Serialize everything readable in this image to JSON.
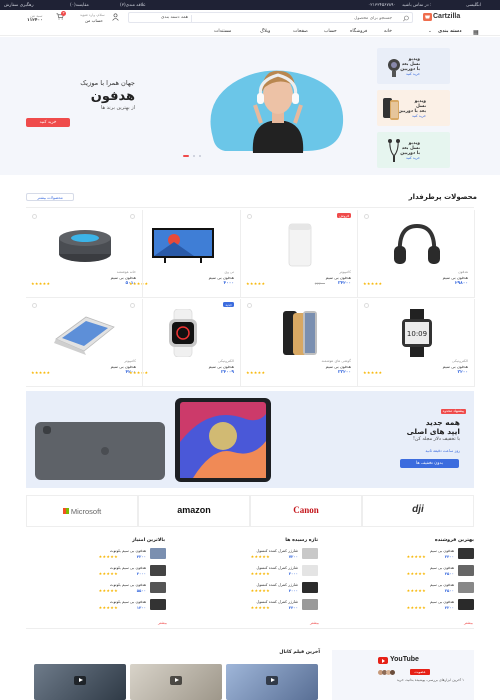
{
  "topbar": {
    "language": "انگلیسی",
    "phone": "۰۲۱۳۳۴۵۶۷۸۹۰",
    "phone_label": "در تماس باشید :",
    "compare": "مقایسه(۰)",
    "wishlist": "علاقه مندی(۳)",
    "tracking": "رهگیری سفارش"
  },
  "header": {
    "logo": "Cartzilla",
    "search_placeholder": "جستجو برای محصول",
    "category": "همه دسته بندی",
    "account_top": "سلام، وارد شوید",
    "account_bottom": "حساب من",
    "cart_top": "سبد من",
    "cart_total": "۱۱۲۴۰۰",
    "cart_count": "۳"
  },
  "nav": {
    "menu": "دسته بندی",
    "items": [
      "خانه",
      "فروشگاه",
      "حساب",
      "صفحات",
      "وبلاگ",
      "مستندات"
    ]
  },
  "hero": {
    "subtitle": "جهان همرا با موزیک",
    "title": "هدفون",
    "tagline": "از بهترین برند ها",
    "button": "خرید کنید",
    "side_cards": [
      {
        "title": "ویدیو",
        "line2": "نسل بعد",
        "line3": "با دوربین",
        "link": "خرید کنید",
        "color": "#e9eef8"
      },
      {
        "title": "ویدیو",
        "line2": "نسل",
        "line3": "بعد با دوربین",
        "link": "خرید کنید",
        "color": "#fbf0e6"
      },
      {
        "title": "ویدیو",
        "line2": "نسل بعد",
        "line3": "با دوربین",
        "link": "خرید کنید",
        "color": "#e6f5ef"
      }
    ]
  },
  "products": {
    "title": "محصولات پرطرفدار",
    "more_button": "محصولات بیشتر",
    "items": [
      {
        "cat": "هدفون",
        "name": "هدفون بی سیم",
        "price": "۲۹۸۰۰",
        "old": "",
        "badge": "",
        "img": "headphones"
      },
      {
        "cat": "کامپیوتر",
        "name": "هدفون بی سیم",
        "price": "۳۴۲۰۰",
        "old": "۴۴۴۰۰",
        "badge": "فروش",
        "img": "router"
      },
      {
        "cat": "تی وی",
        "name": "هدفون بی سیم",
        "price": "۴۰۰۰",
        "old": "",
        "badge": "",
        "img": "tv"
      },
      {
        "cat": "خانه هوشمند",
        "name": "هدفون بی سیم",
        "price": "۵۰۱۰",
        "old": "",
        "badge": "",
        "img": "speaker"
      },
      {
        "cat": "الکترونیکی",
        "name": "هدفون بی سیم",
        "price": "۳۲۰۰",
        "old": "",
        "badge": "",
        "img": "watch"
      },
      {
        "cat": "گوشی های هوشمند",
        "name": "هدفون بی سیم",
        "price": "۳۳۲۰۰",
        "old": "",
        "badge": "",
        "img": "phones"
      },
      {
        "cat": "الکترونیکی",
        "name": "هدفون بی سیم",
        "price": "۳۴۰۰۹",
        "old": "",
        "badge": "جدید",
        "img": "applewatch"
      },
      {
        "cat": "کامپیوتر",
        "name": "هدفون بی سیم",
        "price": "۴۲۰۰",
        "old": "",
        "badge": "",
        "img": "laptop"
      }
    ]
  },
  "banner": {
    "badge": "پیشنهاد محدود",
    "line1": "همه جدید",
    "line2": "ایپد های اصلی",
    "line3": "با تخفیف دلار مجله کن!",
    "countdown": "روز  ساعت  دقیقه  ثانیه",
    "button": "بدون تخفیف ها"
  },
  "brands": [
    "Microsoft",
    "amazon",
    "Canon",
    "dji"
  ],
  "lists": {
    "best_sellers": {
      "title": "بهترین فروشنده",
      "items": [
        {
          "name": "هدفون بی سیم",
          "price": "۲۴۰۰"
        },
        {
          "name": "هدفون بی سیم",
          "price": "۳۵۰۰"
        },
        {
          "name": "هدفون بی سیم",
          "price": "۲۵۰۰"
        },
        {
          "name": "هدفون بی سیم",
          "price": "۳۲۰۰"
        }
      ]
    },
    "new_arrivals": {
      "title": "تازه رسیده ها",
      "items": [
        {
          "name": "شارژر کنترل کننده کنسول",
          "price": "۷۲۰۰"
        },
        {
          "name": "شارژر کنترل کننده کنسول",
          "price": "۲۰۰۰"
        },
        {
          "name": "شارژر کنترل کننده کنسول",
          "price": "۴۰۰۰"
        },
        {
          "name": "شارژر کنترل کننده کنسول",
          "price": "۲۴۰۰"
        }
      ]
    },
    "top_rated": {
      "title": "بالاترین امتیاز",
      "items": [
        {
          "name": "هدفون بی سیم بلوتوث",
          "price": "۴۲۰۰"
        },
        {
          "name": "هدفون بی سیم بلوتوث",
          "price": "۳۰۰۰"
        },
        {
          "name": "هدفون بی سیم بلوتوث",
          "price": "۵۵۰۰"
        },
        {
          "name": "هدفون بی سیم بلوتوث",
          "price": "۱۳۰۰"
        }
      ]
    },
    "more_label": "بیشتر"
  },
  "videos": {
    "title": "آخرین فیلم کانال",
    "youtube": "YouTube",
    "subscribe": "عضویت",
    "promo": "۱ آخرین ابزارهای بررسی، پوشیده بدانید، خرید"
  },
  "colors": {
    "accent": "#3c6cde",
    "danger": "#ef4b4b",
    "dark": "#1f2235"
  }
}
